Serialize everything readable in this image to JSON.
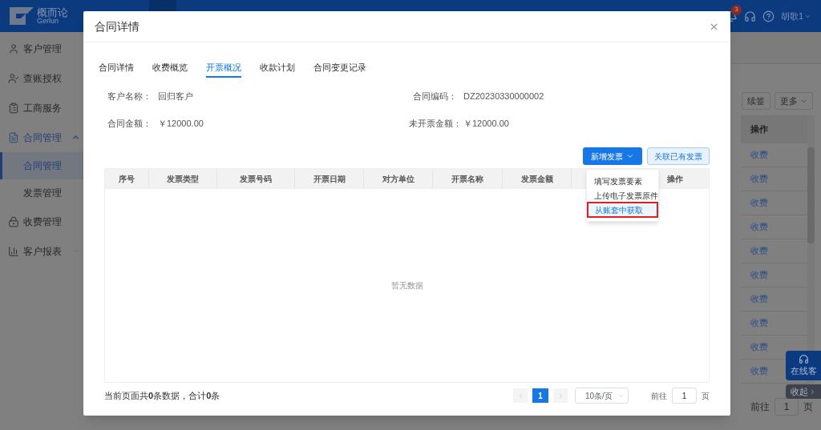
{
  "header": {
    "logo_name": "概而论",
    "logo_sub": "Gerlun",
    "notifications": "3",
    "user": "胡歌1"
  },
  "sidebar": {
    "items": [
      {
        "label": "客户管理"
      },
      {
        "label": "查账授权"
      },
      {
        "label": "工商服务"
      },
      {
        "label": "合同管理",
        "expanded": true,
        "children": [
          {
            "label": "合同管理",
            "selected": true
          },
          {
            "label": "发票管理",
            "selected": false
          }
        ]
      },
      {
        "label": "收费管理"
      },
      {
        "label": "客户报表",
        "expanded": false
      }
    ]
  },
  "background_table": {
    "toolbar": [
      "续签",
      "更多"
    ],
    "column": "操作",
    "rows": [
      "收费",
      "收费",
      "收费",
      "收费",
      "收费",
      "收费",
      "收费",
      "收费",
      "收费",
      "收费"
    ],
    "goto_label": "前往",
    "goto_value": "1",
    "goto_unit": "页"
  },
  "floating": {
    "service": "在线客",
    "collapse": "收起"
  },
  "modal": {
    "title": "合同详情",
    "tabs": [
      {
        "label": "合同详情",
        "selected": false
      },
      {
        "label": "收费概览",
        "selected": false
      },
      {
        "label": "开票概况",
        "selected": true
      },
      {
        "label": "收款计划",
        "selected": false
      },
      {
        "label": "合同变更记录",
        "selected": false
      }
    ],
    "fields": [
      {
        "label": "客户名称：",
        "value": "回归客户"
      },
      {
        "label": "合同编码：",
        "value": "DZ20230330000002"
      },
      {
        "label": "合同金额：",
        "value": "￥12000.00"
      },
      {
        "label": "未开票金额：",
        "value": "￥12000.00"
      }
    ],
    "primary_button": "新增发票",
    "secondary_button": "关联已有发票",
    "dropdown": [
      {
        "label": "填写发票要素",
        "highlighted": false
      },
      {
        "label": "上传电子发票原件",
        "highlighted": false
      },
      {
        "label": "从账套中获取",
        "highlighted": true
      }
    ],
    "table": {
      "columns": [
        {
          "label": "序号"
        },
        {
          "label": "发票类型"
        },
        {
          "label": "发票号码"
        },
        {
          "label": "开票日期"
        },
        {
          "label": "对方单位"
        },
        {
          "label": "开票名称"
        },
        {
          "label": "发票金额"
        },
        {
          "label": "操作"
        }
      ],
      "empty_text": "暂无数据"
    },
    "footer": {
      "summary": "当前页面共**0**条数据，合计**0**条",
      "pages": [
        {
          "label": "1",
          "selected": true
        }
      ],
      "page_size": "10条/页",
      "goto_label": "前往",
      "goto_value": "1",
      "goto_unit": "页"
    }
  }
}
